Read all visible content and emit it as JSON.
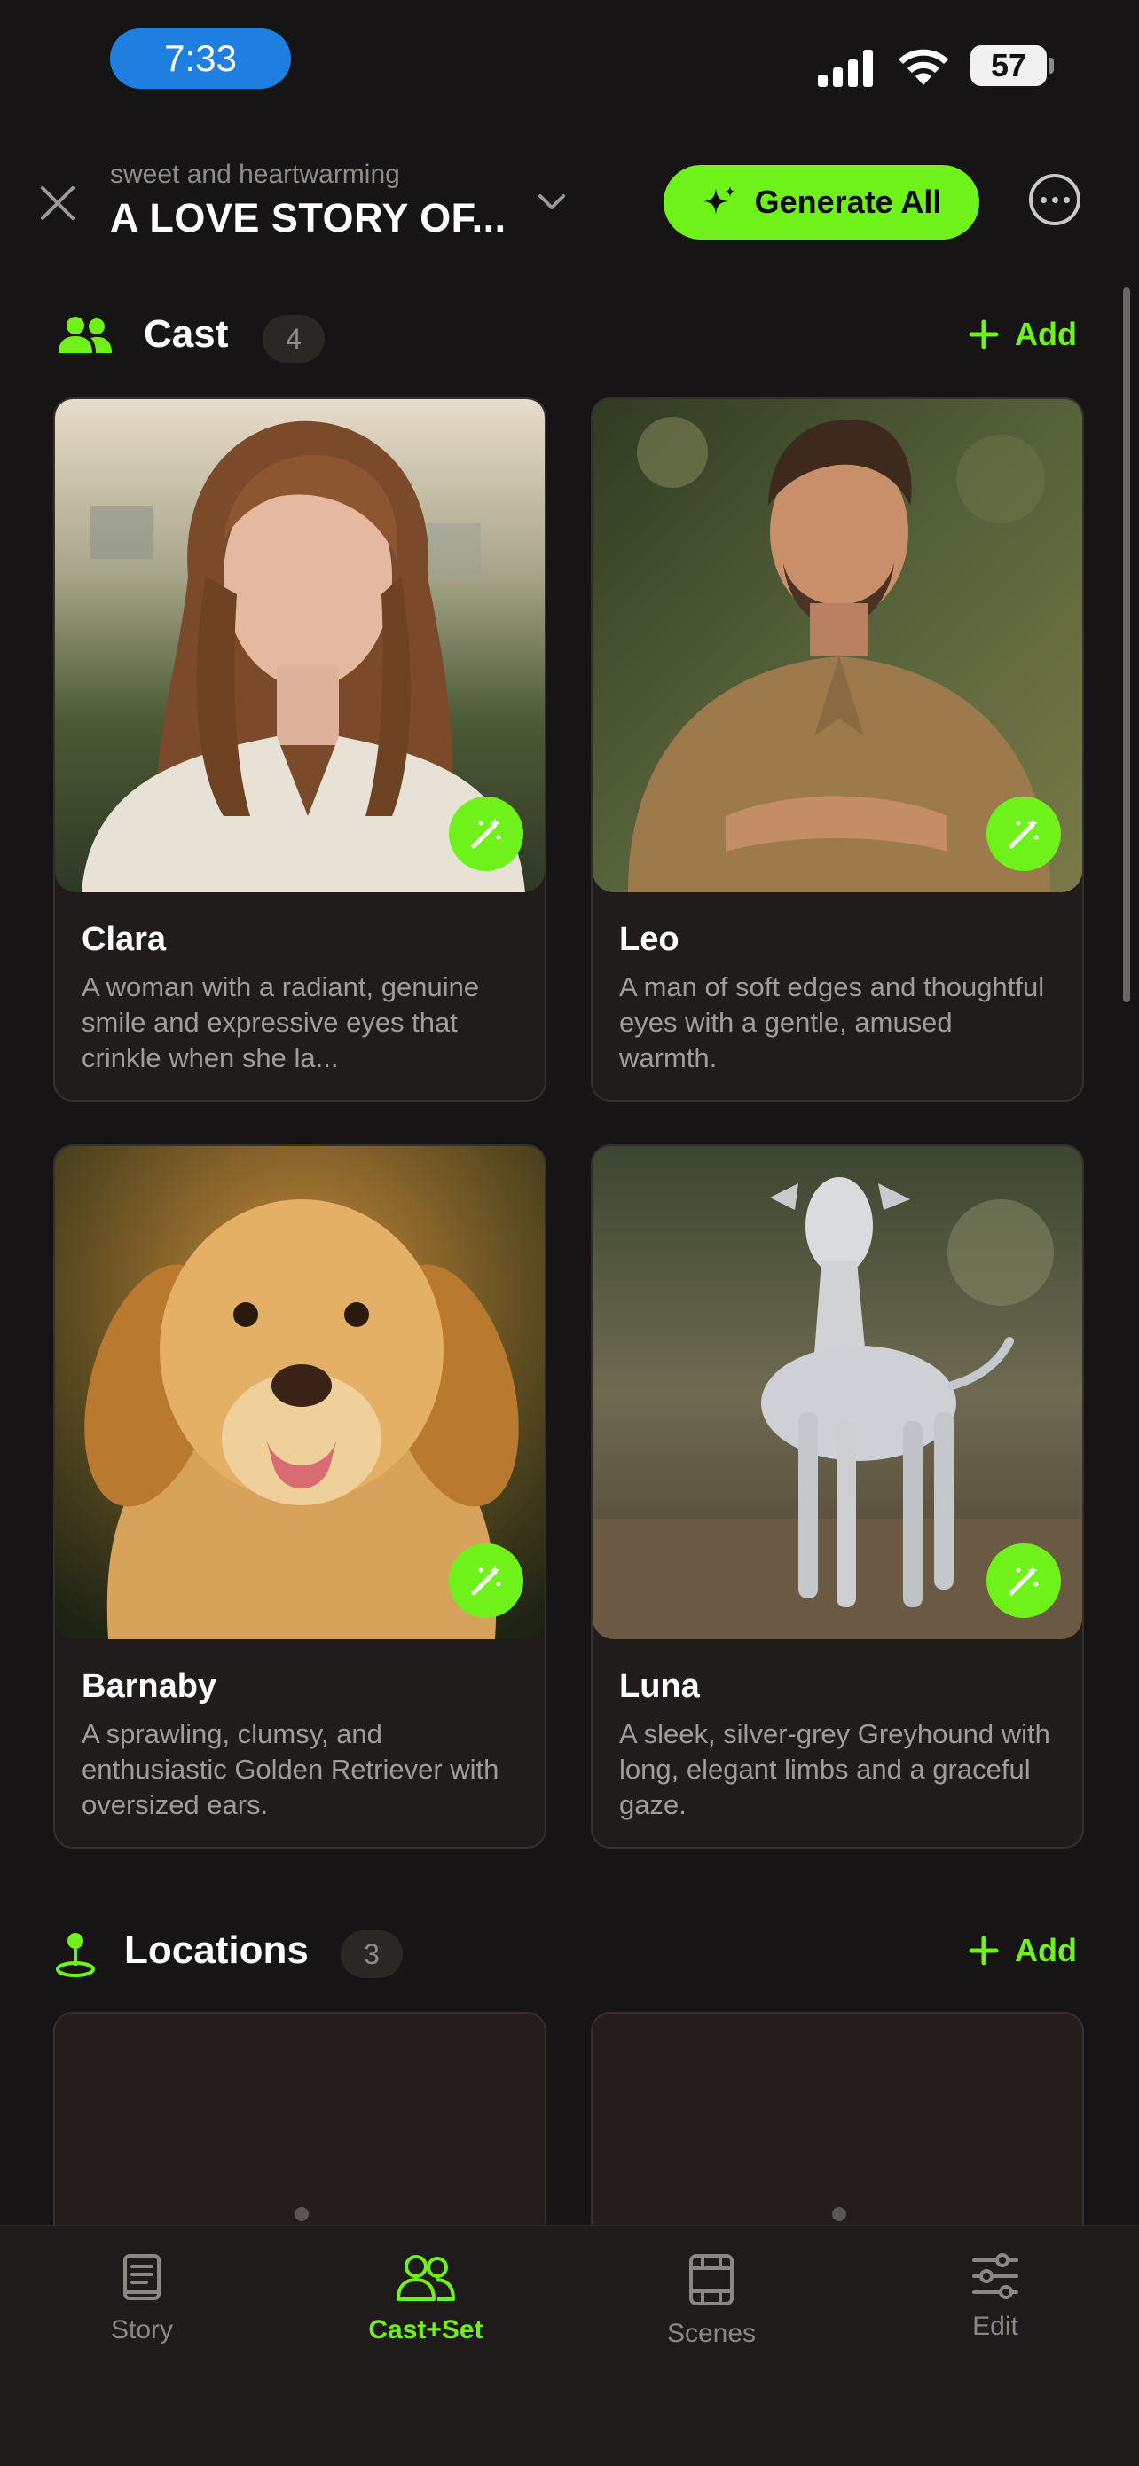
{
  "status_bar": {
    "time": "7:33",
    "battery": "57"
  },
  "header": {
    "subtitle": "sweet and heartwarming",
    "title": "A LOVE STORY OF...",
    "generate_label": "Generate All"
  },
  "cast": {
    "title": "Cast",
    "count": "4",
    "add_label": "Add",
    "members": [
      {
        "name": "Clara",
        "description": "A woman with a radiant, genuine smile and expressive eyes that crinkle when she la..."
      },
      {
        "name": "Leo",
        "description": "A man of soft edges and thoughtful eyes with a gentle, amused warmth."
      },
      {
        "name": "Barnaby",
        "description": "A sprawling, clumsy, and enthusiastic Golden Retriever with oversized ears."
      },
      {
        "name": "Luna",
        "description": "A sleek, silver-grey Greyhound with long, elegant limbs and a graceful gaze."
      }
    ]
  },
  "locations": {
    "title": "Locations",
    "count": "3",
    "add_label": "Add"
  },
  "tabs": [
    {
      "label": "Story",
      "icon": "book-icon",
      "active": false
    },
    {
      "label": "Cast+Set",
      "icon": "people-icon",
      "active": true
    },
    {
      "label": "Scenes",
      "icon": "film-icon",
      "active": false
    },
    {
      "label": "Edit",
      "icon": "sliders-icon",
      "active": false
    }
  ],
  "colors": {
    "accent": "#6ef21a",
    "background": "#161414",
    "card": "#201c1b",
    "time_pill": "#1e7fe0"
  }
}
